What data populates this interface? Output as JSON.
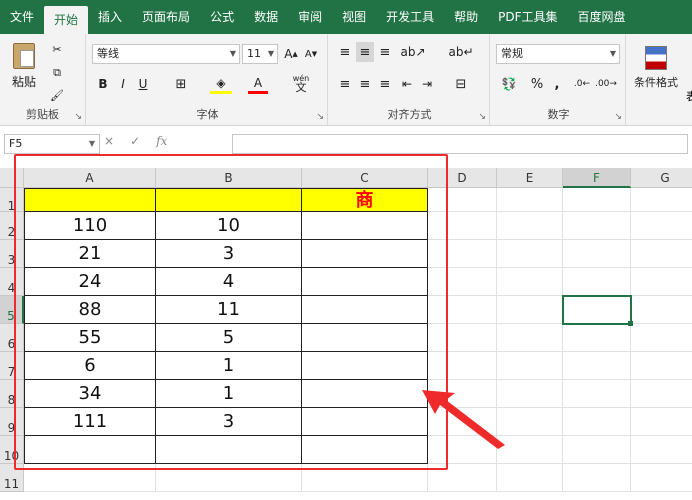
{
  "tabs": [
    "文件",
    "开始",
    "插入",
    "页面布局",
    "公式",
    "数据",
    "审阅",
    "视图",
    "开发工具",
    "帮助",
    "PDF工具集",
    "百度网盘"
  ],
  "active_tab_index": 1,
  "ribbon": {
    "clipboard": {
      "paste_label": "粘贴",
      "group_label": "剪贴板"
    },
    "font": {
      "font_name": "等线",
      "font_size": "11",
      "bold": "B",
      "italic": "I",
      "underline": "U",
      "phonetic": "wén",
      "group_label": "字体"
    },
    "alignment": {
      "group_label": "对齐方式"
    },
    "number": {
      "format": "常规",
      "percent": "%",
      "comma": ",",
      "group_label": "数字"
    },
    "styles": {
      "conditional_format": "条件格式",
      "partial_label": "表"
    }
  },
  "formula_bar": {
    "name_box": "F5",
    "fx": "fx",
    "cancel": "×",
    "enter": "✓",
    "formula": ""
  },
  "columns": [
    "A",
    "B",
    "C",
    "D",
    "E",
    "F",
    "G"
  ],
  "rows": [
    "1",
    "2",
    "3",
    "4",
    "5",
    "6",
    "7",
    "8",
    "9",
    "10",
    "11"
  ],
  "selected_column": "F",
  "selected_row": "5",
  "header_cell_c1": "商",
  "table": [
    [
      "110",
      "10"
    ],
    [
      "21",
      "3"
    ],
    [
      "24",
      "4"
    ],
    [
      "88",
      "11"
    ],
    [
      "55",
      "5"
    ],
    [
      "6",
      "1"
    ],
    [
      "34",
      "1"
    ],
    [
      "111",
      "3"
    ]
  ],
  "colors": {
    "accent": "#217346",
    "header_fill": "#ffff00",
    "header_text": "#ff0000",
    "annotation": "#ee2a2a"
  }
}
